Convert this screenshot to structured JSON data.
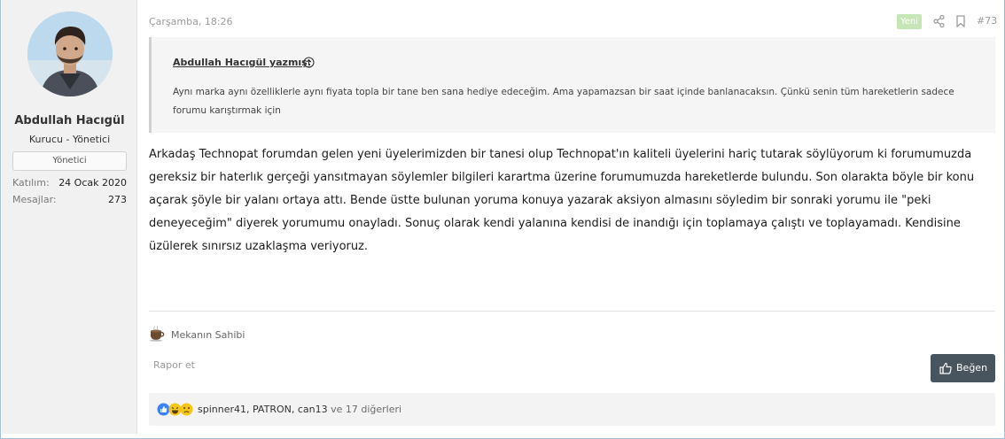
{
  "user": {
    "name": "Abdullah Hacıgül",
    "title": "Kurucu - Yönetici",
    "banner": "Yönetici",
    "joined_label": "Katılım:",
    "joined_value": "24 Ocak 2020",
    "messages_label": "Mesajlar:",
    "messages_value": "273"
  },
  "post": {
    "date": "Çarşamba, 18:26",
    "new_badge": "Yeni",
    "number": "#73",
    "quote": {
      "author": "Abdullah Hacıgül yazmış:",
      "text": "Aynı marka aynı özelliklerle aynı fiyata topla bir tane ben sana hediye edeceğim. Ama yapamazsan bir saat içinde banlanacaksın. Çünkü senin tüm hareketlerin sadece forumu karıştırmak için"
    },
    "body": "Arkadaş Technopat forumdan gelen yeni üyelerimizden bir tanesi olup Technopat'ın kaliteli üyelerini hariç tutarak söylüyorum ki forumumuzda gereksiz bir haterlık gerçeği yansıtmayan söylemler bilgileri karartma üzerine forumumuzda hareketlerde bulundu. Son olarakta böyle bir konu açarak şöyle bir yalanı ortaya attı. Bende üstte bulunan yoruma konuya yazarak aksiyon almasını söyledim bir sonraki yorumu ile \"peki deneyeceğim\" diyerek yorumumu onayladı. Sonuç olarak kendi yalanına kendisi de inandığı için toplamaya çalıştı ve toplayamadı. Kendisine üzülerek sınırsız uzaklaşma veriyoruz.",
    "signature": "Mekanın Sahibi",
    "report_label": "Rapor et",
    "like_label": "Beğen",
    "reactions": {
      "users": "spinner41, PATRON, can13",
      "others": "ve 17 diğerleri"
    }
  },
  "icons": {
    "avatar": "user-avatar-photo",
    "share": "share-icon",
    "bookmark": "bookmark-icon",
    "quote_arrow": "circle-arrow-up-icon",
    "coffee": "coffee-icon",
    "thumb": "thumbs-up-icon"
  },
  "colors": {
    "new_badge": "#c7e6b5",
    "like_button": "#48545e",
    "user_cell": "#f1f1f1",
    "reaction_like": "#3b82f6",
    "reaction_emoji": "#f5c518"
  }
}
